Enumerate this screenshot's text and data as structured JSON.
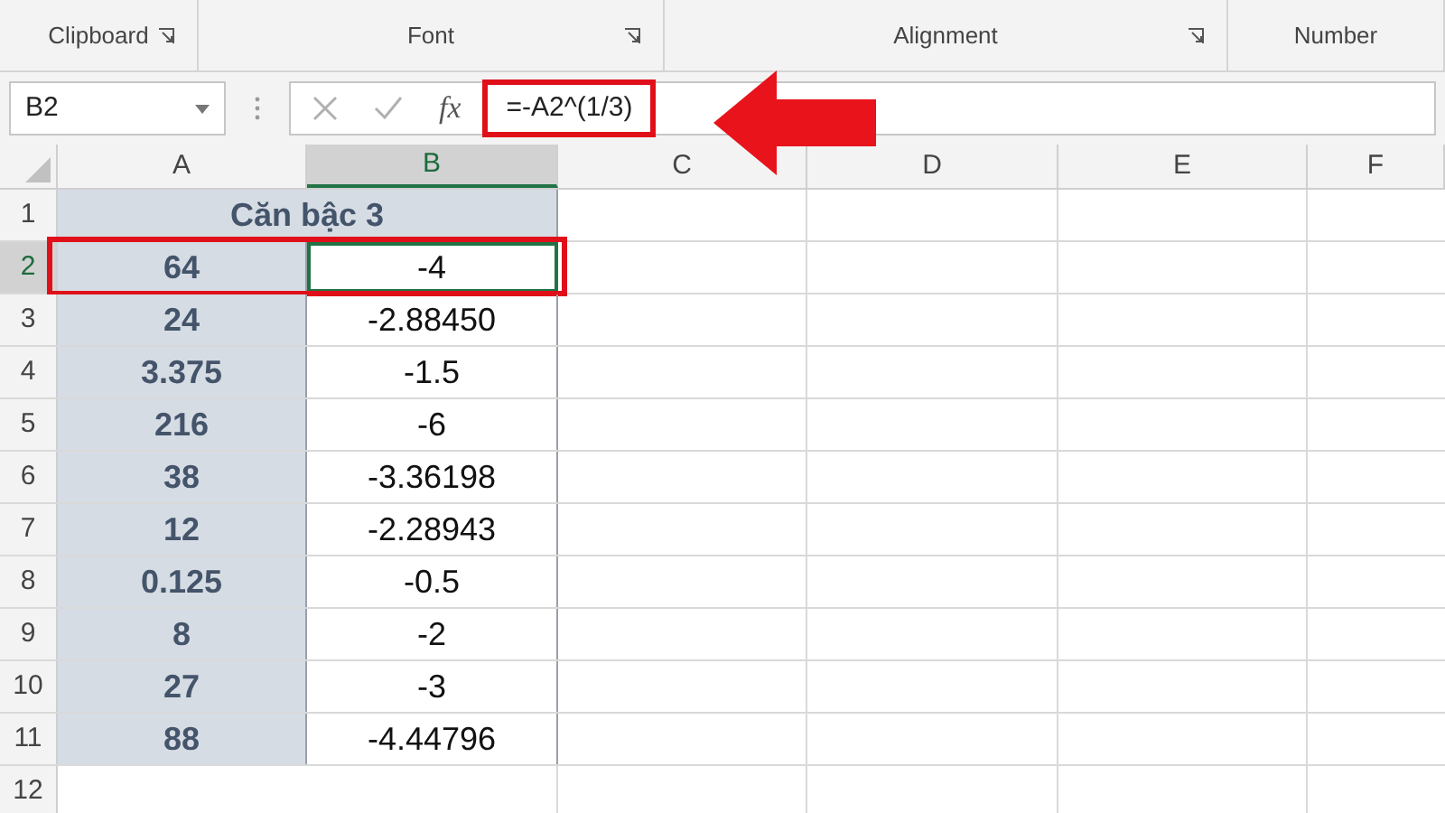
{
  "ribbon_groups": [
    {
      "label": "Clipboard",
      "launcher": true
    },
    {
      "label": "Font",
      "launcher": true
    },
    {
      "label": "Alignment",
      "launcher": true
    },
    {
      "label": "Number",
      "launcher": false
    }
  ],
  "formula_bar": {
    "name_box": "B2",
    "formula": "=-A2^(1/3)",
    "highlighted": true,
    "fx": "fx"
  },
  "columns": [
    {
      "label": "A",
      "selected": false
    },
    {
      "label": "B",
      "selected": true
    },
    {
      "label": "C",
      "selected": false
    },
    {
      "label": "D",
      "selected": false
    },
    {
      "label": "E",
      "selected": false
    },
    {
      "label": "F",
      "selected": false
    }
  ],
  "header_cell": "Căn bậc 3",
  "rows": [
    {
      "number": "1",
      "selected": false
    },
    {
      "number": "2",
      "a": "64",
      "b": "-4",
      "selected": true,
      "highlighted": true
    },
    {
      "number": "3",
      "a": "24",
      "b": "-2.88450",
      "selected": false,
      "highlighted": false
    },
    {
      "number": "4",
      "a": "3.375",
      "b": "-1.5",
      "selected": false,
      "highlighted": false
    },
    {
      "number": "5",
      "a": "216",
      "b": "-6",
      "selected": false,
      "highlighted": false
    },
    {
      "number": "6",
      "a": "38",
      "b": "-3.36198",
      "selected": false,
      "highlighted": false
    },
    {
      "number": "7",
      "a": "12",
      "b": "-2.28943",
      "selected": false,
      "highlighted": false
    },
    {
      "number": "8",
      "a": "0.125",
      "b": "-0.5",
      "selected": false,
      "highlighted": false
    },
    {
      "number": "9",
      "a": "8",
      "b": "-2",
      "selected": false,
      "highlighted": false
    },
    {
      "number": "10",
      "a": "27",
      "b": "-3",
      "selected": false,
      "highlighted": false
    },
    {
      "number": "11",
      "a": "88",
      "b": "-4.44796",
      "selected": false,
      "highlighted": false
    },
    {
      "number": "12",
      "selected": false
    }
  ]
}
